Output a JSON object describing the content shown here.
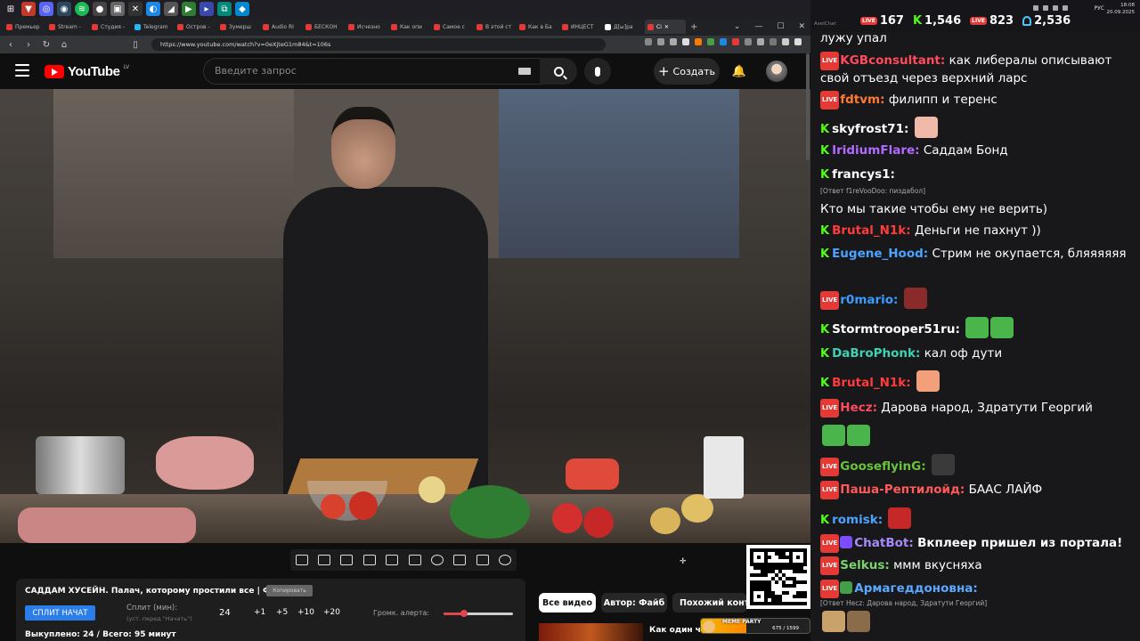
{
  "browser": {
    "tabs": [
      {
        "label": "Премьер"
      },
      {
        "label": "Stream -"
      },
      {
        "label": "Студия -"
      },
      {
        "label": "Telegram"
      },
      {
        "label": "Остров -"
      },
      {
        "label": "Зумерш"
      },
      {
        "label": "Audio RI"
      },
      {
        "label": "БЕСКОН"
      },
      {
        "label": "Исчезно"
      },
      {
        "label": "Как опи"
      },
      {
        "label": "Самое с"
      },
      {
        "label": "В этой ст"
      },
      {
        "label": "Как в Ба"
      },
      {
        "label": "ИНЦЕСТ"
      },
      {
        "label": "Д[ы]ра"
      },
      {
        "label": "Сі"
      }
    ],
    "url": "https://www.youtube.com/watch?v=0eXjteG1m84&t=106s"
  },
  "youtube": {
    "logo_text": "YouTube",
    "country": "LV",
    "search_placeholder": "Введите запрос",
    "create_label": "Создать"
  },
  "video_info": {
    "title": "САДДАМ ХУСЕЙН. Палач, которому простили все | ФАЙБ",
    "copy_label": "Копировать",
    "split_start_label": "СПЛИТ НАЧАТ",
    "split_min_label": "Сплит (мин):",
    "split_note": "(уст. перед \"Начать\")",
    "split_value": "24",
    "increments": [
      "+1",
      "+5",
      "+10",
      "+20"
    ],
    "alert_volume_label": "Громк. алерта:",
    "alert_volume_fraction": 0.3,
    "bought": "Выкуплено: 24 / Всего: 95 минут"
  },
  "chips": {
    "all_videos": "Все видео",
    "author": "Автор: Файб",
    "similar": "Похожий контент"
  },
  "recommendation": {
    "title": "Как один чел"
  },
  "meme_party": {
    "label": "MEME PARTY",
    "count": "675 / 1599",
    "progress_fraction": 0.42
  },
  "system": {
    "lang": "РУС",
    "time": "18:08",
    "date": "20.09.2025",
    "app_title": "AxelChat"
  },
  "stats": {
    "s1": "167",
    "s2": "1,546",
    "s3": "823",
    "s4": "2,536"
  },
  "chat": [
    {
      "platform": "",
      "nick": "",
      "text": "лужу упал",
      "nick_color": "#ffffff"
    },
    {
      "platform": "live",
      "nick": "KGBconsultant:",
      "text": "как либералы описывают свой отъезд через верхний ларс",
      "nick_color": "#ff4b5c"
    },
    {
      "platform": "live",
      "nick": "fdtvm:",
      "text": "филипп и теренс",
      "nick_color": "#ff7a2f"
    },
    {
      "platform": "kick",
      "nick": "skyfrost71:",
      "text": "",
      "nick_color": "#ffffff"
    },
    {
      "platform": "kick",
      "nick": "IridiumFlare:",
      "text": "Саддам Бонд",
      "nick_color": "#b36bff"
    },
    {
      "platform": "kick",
      "nick": "francys1:",
      "text": "",
      "nick_color": "#ffffff"
    },
    {
      "platform": "",
      "nick": "",
      "text": "Кто мы такие чтобы ему не верить)",
      "nick_color": "#ffffff"
    },
    {
      "platform": "kick",
      "nick": "Brutal_N1k:",
      "text": "Деньги не пахнут ))",
      "nick_color": "#ff3b3b"
    },
    {
      "platform": "kick",
      "nick": "Eugene_Hood:",
      "text": "Стрим не окупается, бляяяяяя",
      "nick_color": "#4aa3ff"
    },
    {
      "platform": "live",
      "nick": "r0mario:",
      "text": "",
      "nick_color": "#3b9cff"
    },
    {
      "platform": "kick",
      "nick": "Stormtrooper51ru:",
      "text": "",
      "nick_color": "#ffffff"
    },
    {
      "platform": "kick",
      "nick": "DaBroPhonk:",
      "text": "кал оф дути",
      "nick_color": "#3fd1b4"
    },
    {
      "platform": "kick",
      "nick": "Brutal_N1k:",
      "text": "",
      "nick_color": "#ff3b3b"
    },
    {
      "platform": "live",
      "nick": "Hecz:",
      "text": "Дарова народ, Здратути Георгий",
      "nick_color": "#ff4b5c"
    },
    {
      "platform": "live",
      "nick": "GooseflyinG:",
      "text": "",
      "nick_color": "#68c23c"
    },
    {
      "platform": "live",
      "nick": "Паша-Рептилойд:",
      "text": "БААС ЛАЙФ",
      "nick_color": "#ff5a5a"
    },
    {
      "platform": "kick",
      "nick": "romisk:",
      "text": "",
      "nick_color": "#4aa3ff"
    },
    {
      "platform": "live",
      "nick": "ChatBot:",
      "text": "Вкплеер пришел из портала!",
      "nick_color": "#a78bfa"
    },
    {
      "platform": "live",
      "nick": "Selkus:",
      "text": "ммм вкусняха",
      "nick_color": "#7bd36b"
    },
    {
      "platform": "live",
      "nick": "Армагеддоновна:",
      "text": "",
      "nick_color": "#5aa8ff"
    }
  ],
  "replies": {
    "francys": "[Ответ f1reVooDoo: пиздабол]",
    "armag": "[Ответ Hecz: Дарова народ, Здратути Георгий]"
  }
}
